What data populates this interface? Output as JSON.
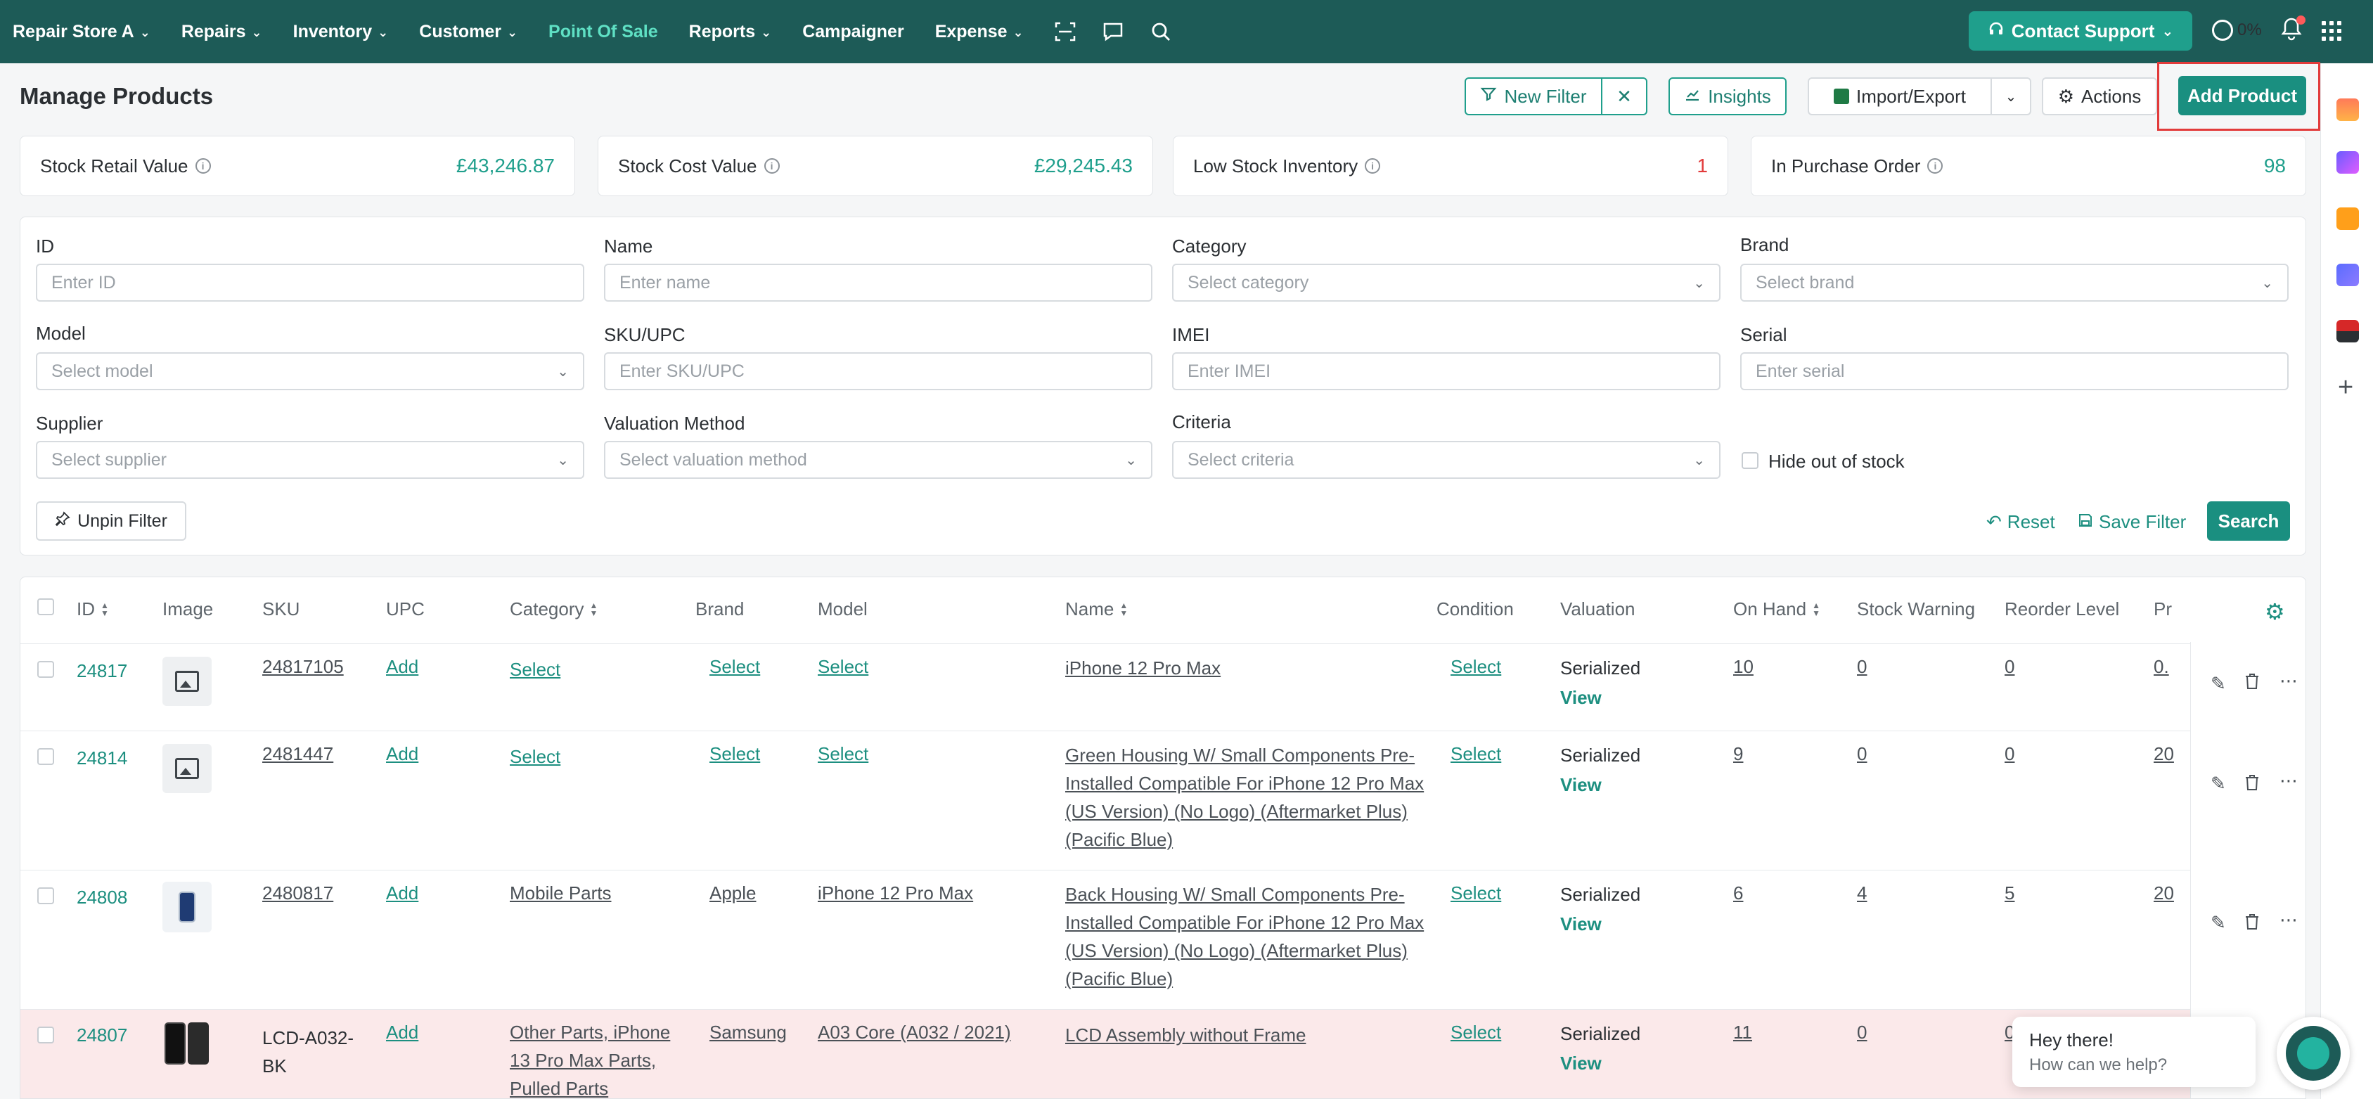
{
  "nav": {
    "store": "Repair Store A",
    "items": [
      "Repairs",
      "Inventory",
      "Customer",
      "Point Of Sale",
      "Reports",
      "Campaigner",
      "Expense"
    ],
    "contact_support": "Contact Support",
    "progress": "0%"
  },
  "header": {
    "title": "Manage Products",
    "new_filter": "New Filter",
    "insights": "Insights",
    "import_export": "Import/Export",
    "actions": "Actions",
    "add_product": "Add Product"
  },
  "stats": [
    {
      "label": "Stock Retail Value",
      "value": "£43,246.87"
    },
    {
      "label": "Stock Cost Value",
      "value": "£29,245.43"
    },
    {
      "label": "Low Stock Inventory",
      "value": "1"
    },
    {
      "label": "In Purchase Order",
      "value": "98"
    }
  ],
  "filters": {
    "id": {
      "label": "ID",
      "placeholder": "Enter ID"
    },
    "name": {
      "label": "Name",
      "placeholder": "Enter name"
    },
    "category": {
      "label": "Category",
      "placeholder": "Select category"
    },
    "brand": {
      "label": "Brand",
      "placeholder": "Select brand"
    },
    "model": {
      "label": "Model",
      "placeholder": "Select model"
    },
    "sku": {
      "label": "SKU/UPC",
      "placeholder": "Enter SKU/UPC"
    },
    "imei": {
      "label": "IMEI",
      "placeholder": "Enter IMEI"
    },
    "serial": {
      "label": "Serial",
      "placeholder": "Enter serial"
    },
    "supplier": {
      "label": "Supplier",
      "placeholder": "Select supplier"
    },
    "valuation": {
      "label": "Valuation Method",
      "placeholder": "Select valuation method"
    },
    "criteria": {
      "label": "Criteria",
      "placeholder": "Select criteria"
    },
    "hide_out_of_stock": "Hide out of stock",
    "unpin": "Unpin Filter",
    "reset": "Reset",
    "save_filter": "Save Filter",
    "search": "Search"
  },
  "table": {
    "headers": [
      "ID",
      "Image",
      "SKU",
      "UPC",
      "Category",
      "Brand",
      "Model",
      "Name",
      "Condition",
      "Valuation",
      "On Hand",
      "Stock Warning",
      "Reorder Level",
      "Pr"
    ],
    "rows": [
      {
        "id": "24817",
        "sku": "24817105",
        "upc": "Add",
        "category": "Select",
        "brand": "Select",
        "model": "Select",
        "name": "iPhone 12 Pro Max",
        "condition": "Select",
        "valuation": "Serialized",
        "view": "View",
        "on_hand": "10",
        "stock_warning": "0",
        "reorder": "0",
        "price": "0."
      },
      {
        "id": "24814",
        "sku": "2481447",
        "upc": "Add",
        "category": "Select",
        "brand": "Select",
        "model": "Select",
        "name_lines": [
          "Green Housing W/ Small Components Pre-",
          "Installed Compatible For iPhone 12 Pro Max",
          "(US Version) (No Logo) (Aftermarket Plus)",
          "(Pacific Blue)"
        ],
        "condition": "Select",
        "valuation": "Serialized",
        "view": "View",
        "on_hand": "9",
        "stock_warning": "0",
        "reorder": "0",
        "price": "20"
      },
      {
        "id": "24808",
        "sku": "2480817",
        "upc": "Add",
        "category": "Mobile Parts",
        "brand": "Apple",
        "model": "iPhone 12 Pro Max",
        "name_lines": [
          "Back Housing W/ Small Components Pre-",
          "Installed Compatible For iPhone 12 Pro Max",
          "(US Version) (No Logo) (Aftermarket Plus)",
          "(Pacific Blue)"
        ],
        "condition": "Select",
        "valuation": "Serialized",
        "view": "View",
        "on_hand": "6",
        "stock_warning": "4",
        "reorder": "5",
        "price": "20"
      },
      {
        "id": "24807",
        "sku_lines": [
          "LCD-A032-",
          "BK"
        ],
        "upc": "Add",
        "category_lines": [
          "Other Parts, iPhone",
          "13 Pro Max Parts,",
          "Pulled Parts"
        ],
        "brand": "Samsung",
        "model": "A03 Core (A032 / 2021)",
        "name": "LCD Assembly without Frame",
        "condition": "Select",
        "valuation": "Serialized",
        "view": "View",
        "on_hand": "11",
        "stock_warning": "0",
        "reorder": "0"
      }
    ]
  },
  "chat": {
    "title": "Hey there!",
    "subtitle": "How can we help?"
  }
}
